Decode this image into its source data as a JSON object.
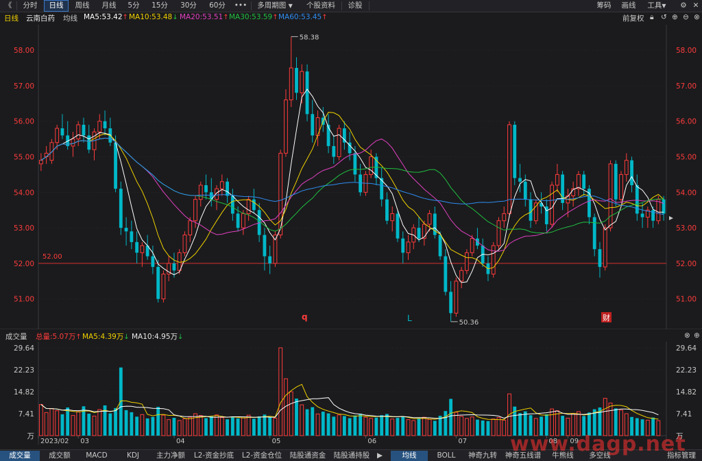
{
  "toolbar": {
    "back": "《",
    "items": [
      "分时",
      "日线",
      "周线",
      "月线",
      "5分",
      "15分",
      "30分",
      "60分",
      "•••",
      "多周期图",
      "个股资料",
      "诊股"
    ],
    "right": [
      "筹码",
      "画线",
      "工具"
    ]
  },
  "info": {
    "period": "日线",
    "stock": "云南白药",
    "ma_label": "均线",
    "ma5": "MA5:53.42",
    "ma10": "MA10:53.48",
    "ma20": "MA20:53.51",
    "ma30": "MA30:53.59",
    "ma60": "MA60:53.45",
    "fq": "前复权",
    "up": "↑",
    "down": "↓"
  },
  "colors": {
    "up": "#ff3b3b",
    "down": "#00b8c8",
    "ma5": "#ffffff",
    "ma10": "#f0d000",
    "ma20": "#e040c0",
    "ma30": "#20c040",
    "ma60": "#2f8cf0",
    "accent": "#3a78c8"
  },
  "main_chart": {
    "y_ticks": [
      "58.00",
      "57.00",
      "56.00",
      "55.00",
      "54.00",
      "53.00",
      "52.00",
      "51.00"
    ],
    "hline_label": "52.00",
    "high_label": "58.38",
    "low_label": "50.36",
    "markers": [
      "q",
      "L",
      "财"
    ]
  },
  "volume": {
    "label": "成交量",
    "total": "总量:5.07万",
    "ma5": "MA5:4.39万",
    "ma10": "MA10:4.95万",
    "y_ticks": [
      "29.64",
      "22.23",
      "14.82",
      "7.41",
      "万"
    ],
    "x_labels": [
      "2023/02",
      "03",
      "04",
      "05",
      "06",
      "07",
      "08",
      "09"
    ]
  },
  "bottom_tabs": {
    "left": [
      "成交量",
      "成交额",
      "MACD",
      "KDJ",
      "主力净额",
      "L2-资金抄底",
      "L2-资金仓位",
      "陆股通资金",
      "陆股通持股"
    ],
    "right": [
      "均线",
      "BOLL",
      "神奇九转",
      "神奇五线谱",
      "牛熊线",
      "多空线"
    ],
    "far_right": "指标管理"
  },
  "watermark": "www.dagp.net",
  "chart_data": {
    "type": "candlestick",
    "ylim": [
      50.3,
      58.6
    ],
    "candles": [
      [
        54.8,
        55.1,
        54.6,
        54.9
      ],
      [
        55.0,
        55.3,
        54.8,
        55.1
      ],
      [
        54.9,
        55.5,
        54.8,
        55.4
      ],
      [
        55.4,
        55.9,
        55.2,
        55.8
      ],
      [
        55.8,
        56.2,
        55.5,
        55.6
      ],
      [
        55.6,
        56.0,
        55.2,
        55.3
      ],
      [
        55.3,
        55.7,
        55.0,
        55.5
      ],
      [
        55.5,
        56.0,
        55.3,
        55.9
      ],
      [
        55.9,
        56.1,
        55.4,
        55.6
      ],
      [
        55.6,
        55.9,
        55.1,
        55.2
      ],
      [
        55.2,
        55.8,
        54.9,
        55.7
      ],
      [
        55.7,
        56.2,
        55.5,
        56.0
      ],
      [
        56.0,
        56.3,
        55.6,
        55.8
      ],
      [
        55.8,
        56.1,
        55.3,
        55.4
      ],
      [
        55.4,
        55.6,
        54.0,
        54.1
      ],
      [
        54.1,
        54.3,
        52.8,
        53.0
      ],
      [
        53.0,
        53.3,
        52.5,
        52.9
      ],
      [
        52.9,
        53.2,
        52.4,
        52.6
      ],
      [
        52.6,
        52.9,
        52.0,
        52.3
      ],
      [
        52.3,
        52.6,
        51.9,
        52.5
      ],
      [
        52.5,
        52.8,
        52.1,
        52.2
      ],
      [
        52.2,
        52.5,
        51.7,
        51.9
      ],
      [
        51.9,
        52.1,
        50.9,
        51.0
      ],
      [
        51.0,
        51.8,
        50.9,
        51.7
      ],
      [
        51.7,
        52.2,
        51.5,
        52.0
      ],
      [
        52.0,
        52.3,
        51.6,
        51.8
      ],
      [
        51.8,
        52.4,
        51.7,
        52.3
      ],
      [
        52.3,
        52.9,
        52.2,
        52.8
      ],
      [
        52.8,
        53.3,
        52.6,
        53.2
      ],
      [
        53.2,
        53.9,
        53.0,
        53.8
      ],
      [
        53.8,
        54.3,
        53.6,
        54.2
      ],
      [
        54.2,
        54.5,
        53.8,
        54.0
      ],
      [
        54.0,
        54.4,
        53.6,
        53.8
      ],
      [
        53.8,
        54.2,
        53.5,
        54.1
      ],
      [
        54.1,
        54.5,
        53.9,
        54.3
      ],
      [
        54.3,
        54.4,
        53.7,
        53.9
      ],
      [
        53.9,
        54.1,
        53.2,
        53.4
      ],
      [
        53.4,
        53.6,
        52.9,
        53.0
      ],
      [
        53.0,
        53.5,
        52.8,
        53.4
      ],
      [
        53.4,
        53.9,
        53.2,
        53.8
      ],
      [
        53.8,
        54.1,
        53.4,
        53.5
      ],
      [
        53.5,
        53.7,
        52.6,
        52.8
      ],
      [
        52.8,
        53.0,
        51.8,
        52.2
      ],
      [
        52.2,
        52.5,
        51.7,
        52.0
      ],
      [
        52.0,
        52.9,
        51.9,
        52.8
      ],
      [
        52.8,
        55.2,
        52.7,
        55.1
      ],
      [
        55.1,
        56.9,
        55.0,
        56.6
      ],
      [
        56.6,
        58.38,
        56.4,
        57.5
      ],
      [
        57.5,
        57.8,
        56.6,
        56.8
      ],
      [
        56.8,
        57.6,
        56.5,
        57.4
      ],
      [
        57.4,
        57.6,
        56.0,
        56.2
      ],
      [
        56.2,
        56.6,
        55.4,
        55.6
      ],
      [
        55.6,
        56.3,
        55.3,
        56.1
      ],
      [
        56.1,
        56.4,
        55.7,
        55.9
      ],
      [
        55.9,
        56.2,
        55.1,
        55.3
      ],
      [
        55.3,
        55.6,
        54.8,
        55.0
      ],
      [
        55.0,
        55.9,
        54.9,
        55.8
      ],
      [
        55.8,
        56.0,
        55.2,
        55.4
      ],
      [
        55.4,
        55.7,
        54.9,
        55.1
      ],
      [
        55.1,
        55.3,
        54.3,
        54.5
      ],
      [
        54.5,
        54.8,
        53.9,
        54.0
      ],
      [
        54.0,
        54.6,
        53.9,
        54.5
      ],
      [
        54.5,
        55.2,
        54.4,
        55.0
      ],
      [
        55.0,
        55.1,
        54.2,
        54.4
      ],
      [
        54.4,
        54.7,
        53.6,
        53.8
      ],
      [
        53.8,
        54.0,
        53.1,
        53.2
      ],
      [
        53.2,
        53.6,
        52.9,
        53.4
      ],
      [
        53.4,
        53.5,
        52.6,
        52.7
      ],
      [
        52.7,
        52.9,
        52.0,
        52.3
      ],
      [
        52.3,
        52.8,
        52.1,
        52.6
      ],
      [
        52.6,
        53.1,
        52.4,
        53.0
      ],
      [
        53.0,
        53.3,
        52.6,
        52.7
      ],
      [
        52.7,
        53.2,
        52.5,
        53.1
      ],
      [
        53.1,
        53.5,
        52.9,
        53.4
      ],
      [
        53.4,
        53.6,
        52.7,
        52.8
      ],
      [
        52.8,
        52.9,
        52.1,
        52.2
      ],
      [
        52.2,
        52.4,
        51.1,
        51.2
      ],
      [
        51.2,
        51.5,
        50.36,
        50.6
      ],
      [
        50.6,
        51.6,
        50.5,
        51.5
      ],
      [
        51.5,
        51.9,
        51.3,
        51.8
      ],
      [
        51.8,
        52.4,
        51.7,
        52.3
      ],
      [
        52.3,
        52.8,
        52.2,
        52.7
      ],
      [
        52.7,
        53.0,
        52.4,
        52.5
      ],
      [
        52.5,
        52.7,
        51.9,
        52.0
      ],
      [
        52.0,
        52.2,
        51.5,
        51.7
      ],
      [
        51.7,
        52.6,
        51.6,
        52.5
      ],
      [
        52.5,
        53.3,
        52.4,
        53.2
      ],
      [
        53.2,
        53.6,
        53.0,
        53.4
      ],
      [
        53.4,
        56.0,
        53.3,
        55.9
      ],
      [
        55.9,
        56.0,
        54.2,
        54.4
      ],
      [
        54.4,
        54.8,
        54.0,
        54.3
      ],
      [
        54.3,
        54.5,
        53.6,
        53.8
      ],
      [
        53.8,
        54.0,
        53.0,
        53.2
      ],
      [
        53.2,
        53.8,
        53.1,
        53.7
      ],
      [
        53.7,
        54.0,
        53.4,
        53.6
      ],
      [
        53.6,
        53.8,
        52.9,
        53.1
      ],
      [
        53.1,
        54.3,
        53.0,
        54.2
      ],
      [
        54.2,
        54.8,
        54.0,
        54.5
      ],
      [
        54.5,
        54.6,
        53.5,
        53.7
      ],
      [
        53.7,
        54.1,
        53.3,
        53.9
      ],
      [
        53.9,
        54.3,
        53.6,
        54.1
      ],
      [
        54.1,
        54.6,
        53.9,
        54.5
      ],
      [
        54.5,
        54.6,
        53.9,
        54.1
      ],
      [
        54.1,
        54.2,
        53.1,
        53.3
      ],
      [
        53.3,
        53.4,
        52.2,
        52.4
      ],
      [
        52.4,
        52.6,
        51.6,
        51.9
      ],
      [
        51.9,
        53.1,
        51.8,
        53.0
      ],
      [
        53.0,
        54.9,
        52.9,
        54.8
      ],
      [
        54.8,
        54.9,
        53.6,
        53.8
      ],
      [
        53.8,
        54.6,
        53.7,
        54.5
      ],
      [
        54.5,
        55.1,
        54.3,
        54.9
      ],
      [
        54.9,
        55.0,
        54.0,
        54.2
      ],
      [
        54.2,
        54.5,
        53.2,
        53.4
      ],
      [
        53.4,
        53.7,
        53.0,
        53.3
      ],
      [
        53.3,
        53.6,
        53.0,
        53.5
      ],
      [
        53.5,
        53.6,
        53.0,
        53.2
      ],
      [
        53.2,
        53.9,
        53.1,
        53.8
      ],
      [
        53.8,
        53.9,
        53.2,
        53.4
      ]
    ],
    "volumes": [
      10.5,
      7.8,
      9.1,
      8.4,
      7.2,
      9.5,
      6.8,
      8.1,
      9.9,
      7.4,
      6.6,
      8.8,
      10.2,
      7.5,
      9.3,
      23.0,
      8.6,
      7.9,
      6.4,
      7.1,
      5.8,
      6.3,
      9.7,
      6.9,
      5.4,
      6.0,
      5.1,
      5.7,
      6.2,
      7.4,
      6.8,
      5.9,
      6.6,
      7.0,
      6.1,
      5.5,
      6.4,
      5.8,
      6.0,
      6.9,
      5.7,
      6.5,
      7.1,
      6.3,
      5.9,
      29.64,
      19.2,
      14.8,
      12.5,
      10.4,
      8.9,
      9.6,
      7.3,
      8.1,
      7.5,
      6.4,
      7.0,
      6.6,
      5.9,
      6.8,
      7.4,
      6.2,
      5.8,
      6.1,
      6.9,
      7.3,
      5.6,
      6.0,
      6.5,
      5.4,
      5.1,
      5.9,
      6.2,
      5.5,
      5.0,
      6.7,
      8.3,
      12.4,
      7.9,
      6.5,
      5.8,
      6.3,
      5.4,
      5.1,
      4.9,
      5.6,
      6.1,
      5.2,
      14.1,
      9.8,
      7.6,
      8.2,
      6.9,
      5.8,
      6.4,
      7.2,
      9.0,
      8.4,
      6.7,
      5.9,
      7.5,
      8.1,
      6.6,
      7.8,
      8.9,
      9.5,
      12.6,
      11.0,
      9.2,
      8.6,
      7.4,
      6.3,
      5.9,
      5.5,
      5.2,
      6.1,
      5.07
    ],
    "hline": 52.0
  }
}
